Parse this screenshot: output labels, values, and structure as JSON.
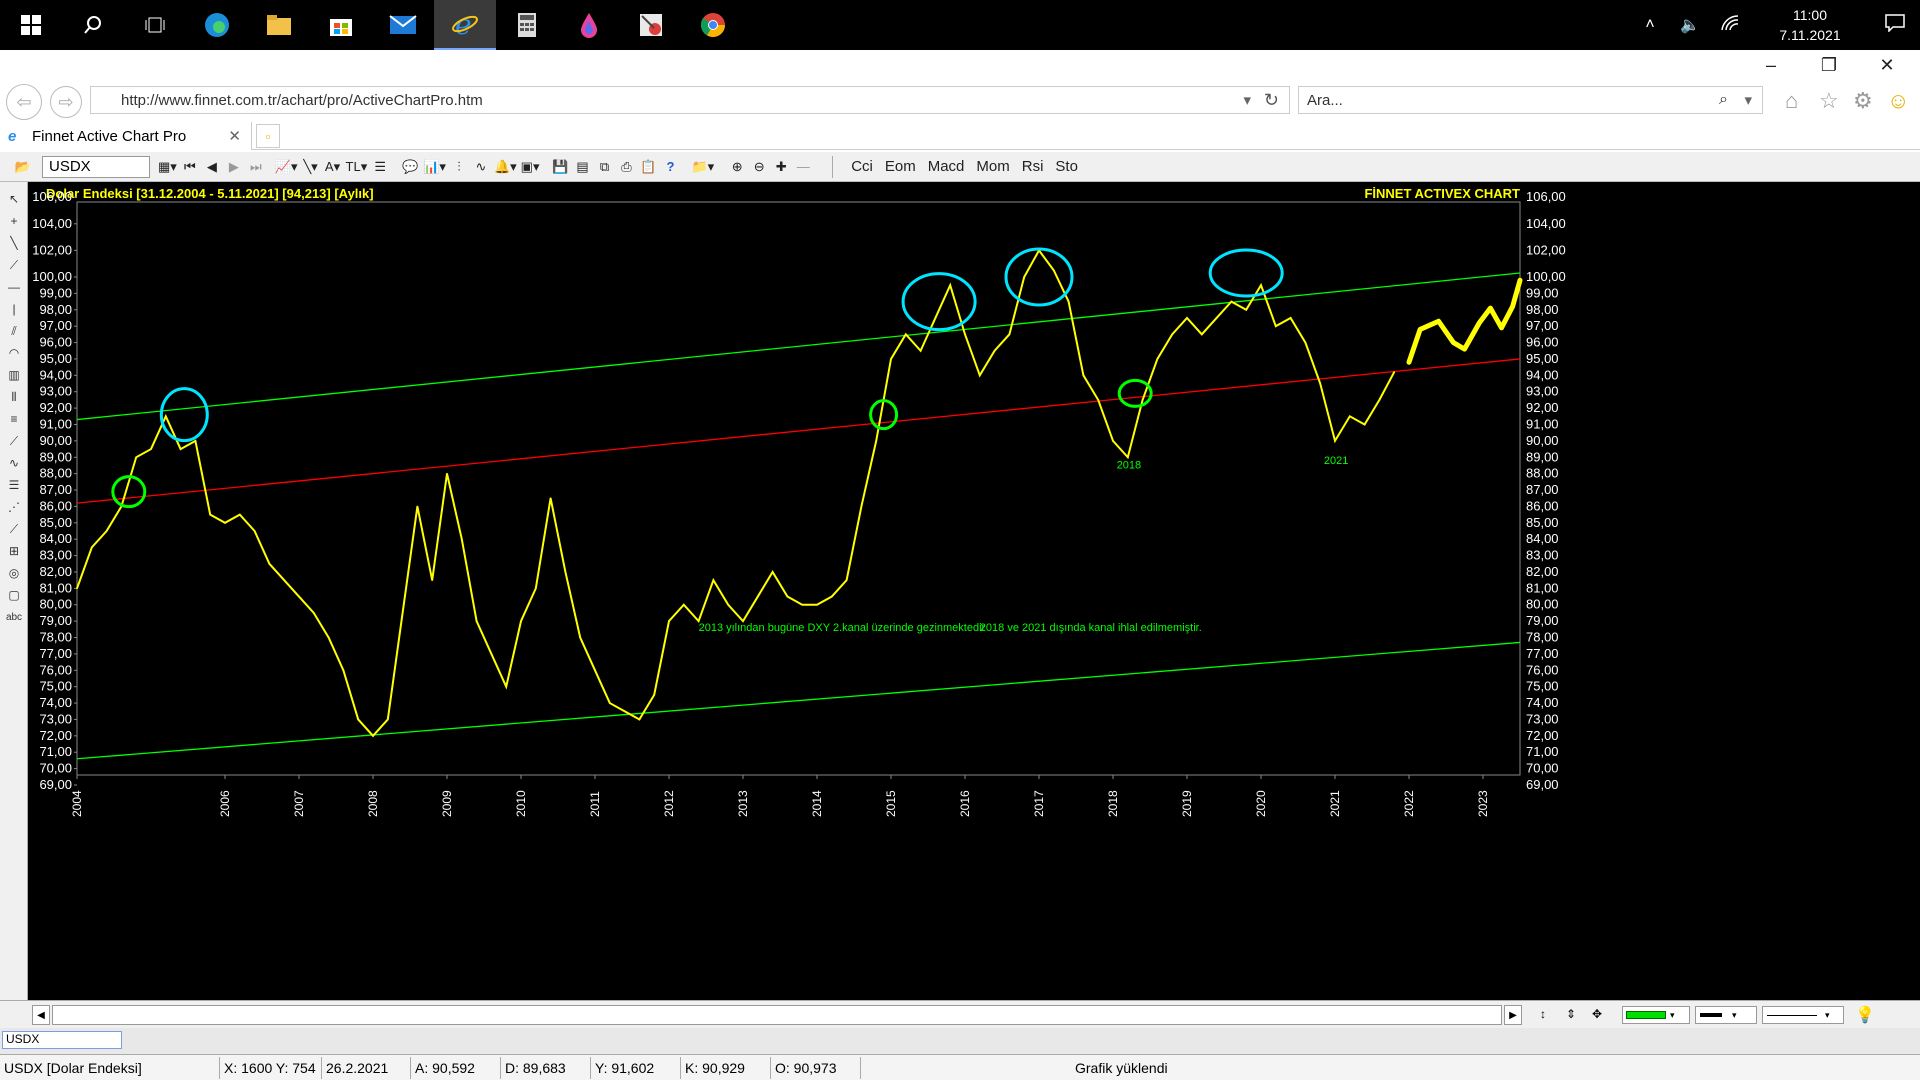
{
  "taskbar": {
    "apps": [
      "windows-start",
      "search",
      "task-view",
      "edge",
      "file-explorer",
      "store",
      "mail",
      "internet-explorer",
      "calculator",
      "paint",
      "snipping",
      "chrome"
    ],
    "time": "11:00",
    "date": "7.11.2021"
  },
  "browser": {
    "url": "http://www.finnet.com.tr/achart/pro/ActiveChartPro.htm",
    "search_placeholder": "Ara...",
    "tab_title": "Finnet Active Chart Pro"
  },
  "toolbar": {
    "symbol": "USDX",
    "currency": "TL",
    "indicators": [
      "Cci",
      "Eom",
      "Macd",
      "Mom",
      "Rsi",
      "Sto"
    ]
  },
  "chart_header": {
    "title": "Dolar Endeksi  [31.12.2004 - 5.11.2021]  [94,213]  [Aylık]",
    "brand": "FİNNET ACTIVEX CHART"
  },
  "chart_data": {
    "type": "line",
    "title": "Dolar Endeksi",
    "ylim": [
      69,
      106.5
    ],
    "y_ticks": [
      "106,00",
      "104,00",
      "102,00",
      "100,00",
      "99,00",
      "98,00",
      "97,00",
      "96,00",
      "95,00",
      "94,00",
      "93,00",
      "92,00",
      "91,00",
      "90,00",
      "89,00",
      "88,00",
      "87,00",
      "86,00",
      "85,00",
      "84,00",
      "83,00",
      "82,00",
      "81,00",
      "80,00",
      "79,00",
      "78,00",
      "77,00",
      "76,00",
      "75,00",
      "74,00",
      "73,00",
      "72,00",
      "71,00",
      "70,00",
      "69,00"
    ],
    "x_ticks": [
      "2004",
      "2006",
      "2007",
      "2008",
      "2009",
      "2010",
      "2011",
      "2012",
      "2013",
      "2014",
      "2015",
      "2016",
      "2017",
      "2018",
      "2019",
      "2020",
      "2021",
      "2022",
      "2023"
    ],
    "series": [
      {
        "color": "#ffff00",
        "x": [
          2004.0,
          2004.2,
          2004.4,
          2004.6,
          2004.8,
          2005.0,
          2005.2,
          2005.4,
          2005.6,
          2005.8,
          2006.0,
          2006.2,
          2006.4,
          2006.6,
          2006.8,
          2007.0,
          2007.2,
          2007.4,
          2007.6,
          2007.8,
          2008.0,
          2008.2,
          2008.4,
          2008.6,
          2008.8,
          2009.0,
          2009.2,
          2009.4,
          2009.6,
          2009.8,
          2010.0,
          2010.2,
          2010.4,
          2010.6,
          2010.8,
          2011.0,
          2011.2,
          2011.4,
          2011.6,
          2011.8,
          2012.0,
          2012.2,
          2012.4,
          2012.6,
          2012.8,
          2013.0,
          2013.2,
          2013.4,
          2013.6,
          2013.8,
          2014.0,
          2014.2,
          2014.4,
          2014.6,
          2014.8,
          2015.0,
          2015.2,
          2015.4,
          2015.6,
          2015.8,
          2016.0,
          2016.2,
          2016.4,
          2016.6,
          2016.8,
          2017.0,
          2017.2,
          2017.4,
          2017.6,
          2017.8,
          2018.0,
          2018.2,
          2018.4,
          2018.6,
          2018.8,
          2019.0,
          2019.2,
          2019.4,
          2019.6,
          2019.8,
          2020.0,
          2020.2,
          2020.4,
          2020.6,
          2020.8,
          2021.0,
          2021.2,
          2021.4,
          2021.6,
          2021.8
        ],
        "y": [
          81.0,
          83.5,
          84.5,
          86.0,
          89.0,
          89.5,
          91.5,
          89.5,
          90.0,
          85.5,
          85.0,
          85.5,
          84.5,
          82.5,
          81.5,
          80.5,
          79.5,
          78.0,
          76.0,
          73.0,
          72.0,
          73.0,
          79.5,
          86.0,
          81.5,
          88.0,
          84.0,
          79.0,
          77.0,
          75.0,
          79.0,
          81.0,
          86.5,
          82.0,
          78.0,
          76.0,
          74.0,
          73.5,
          73.0,
          74.5,
          79.0,
          80.0,
          79.0,
          81.5,
          80.0,
          79.0,
          80.5,
          82.0,
          80.5,
          80.0,
          80.0,
          80.5,
          81.5,
          86.0,
          90.0,
          95.0,
          96.5,
          95.5,
          97.5,
          99.5,
          96.5,
          94.0,
          95.5,
          96.5,
          100.0,
          102.0,
          100.5,
          98.5,
          94.0,
          92.5,
          90.0,
          89.0,
          92.5,
          95.0,
          96.5,
          97.5,
          96.5,
          97.5,
          98.5,
          98.0,
          99.5,
          97.0,
          97.5,
          96.0,
          93.5,
          90.0,
          91.5,
          91.0,
          92.5,
          94.2
        ]
      }
    ],
    "annotations": [
      {
        "text": "2013 yılından bugüne DXY 2.kanal üzerinde gezinmektedir",
        "color": "#00ff00"
      },
      {
        "text": "2018 ve 2021 dışında kanal ihlal edilmemiştir.",
        "color": "#00ff00"
      },
      {
        "text": "2018",
        "color": "#00ff00"
      },
      {
        "text": "2021",
        "color": "#00ff00"
      }
    ],
    "trendlines": [
      {
        "color": "#00ff00",
        "from": [
          2004.0,
          91.3
        ],
        "to": [
          2023.5,
          100.3
        ]
      },
      {
        "color": "#ff0000",
        "from": [
          2004.0,
          86.2
        ],
        "to": [
          2023.5,
          95.0
        ]
      },
      {
        "color": "#00ff00",
        "from": [
          2004.0,
          70.6
        ],
        "to": [
          2023.5,
          77.7
        ]
      }
    ],
    "grid": false,
    "background": "#000000"
  },
  "statusbar": {
    "sheet_tab": "USDX",
    "name": "USDX [Dolar Endeksi]",
    "xy": "X: 1600 Y: 754",
    "date": "26.2.2021",
    "a": "A: 90,592",
    "d": "D: 89,683",
    "y": "Y: 91,602",
    "k": "K: 90,929",
    "o": "O: 90,973",
    "msg": "Grafik yüklendi"
  }
}
